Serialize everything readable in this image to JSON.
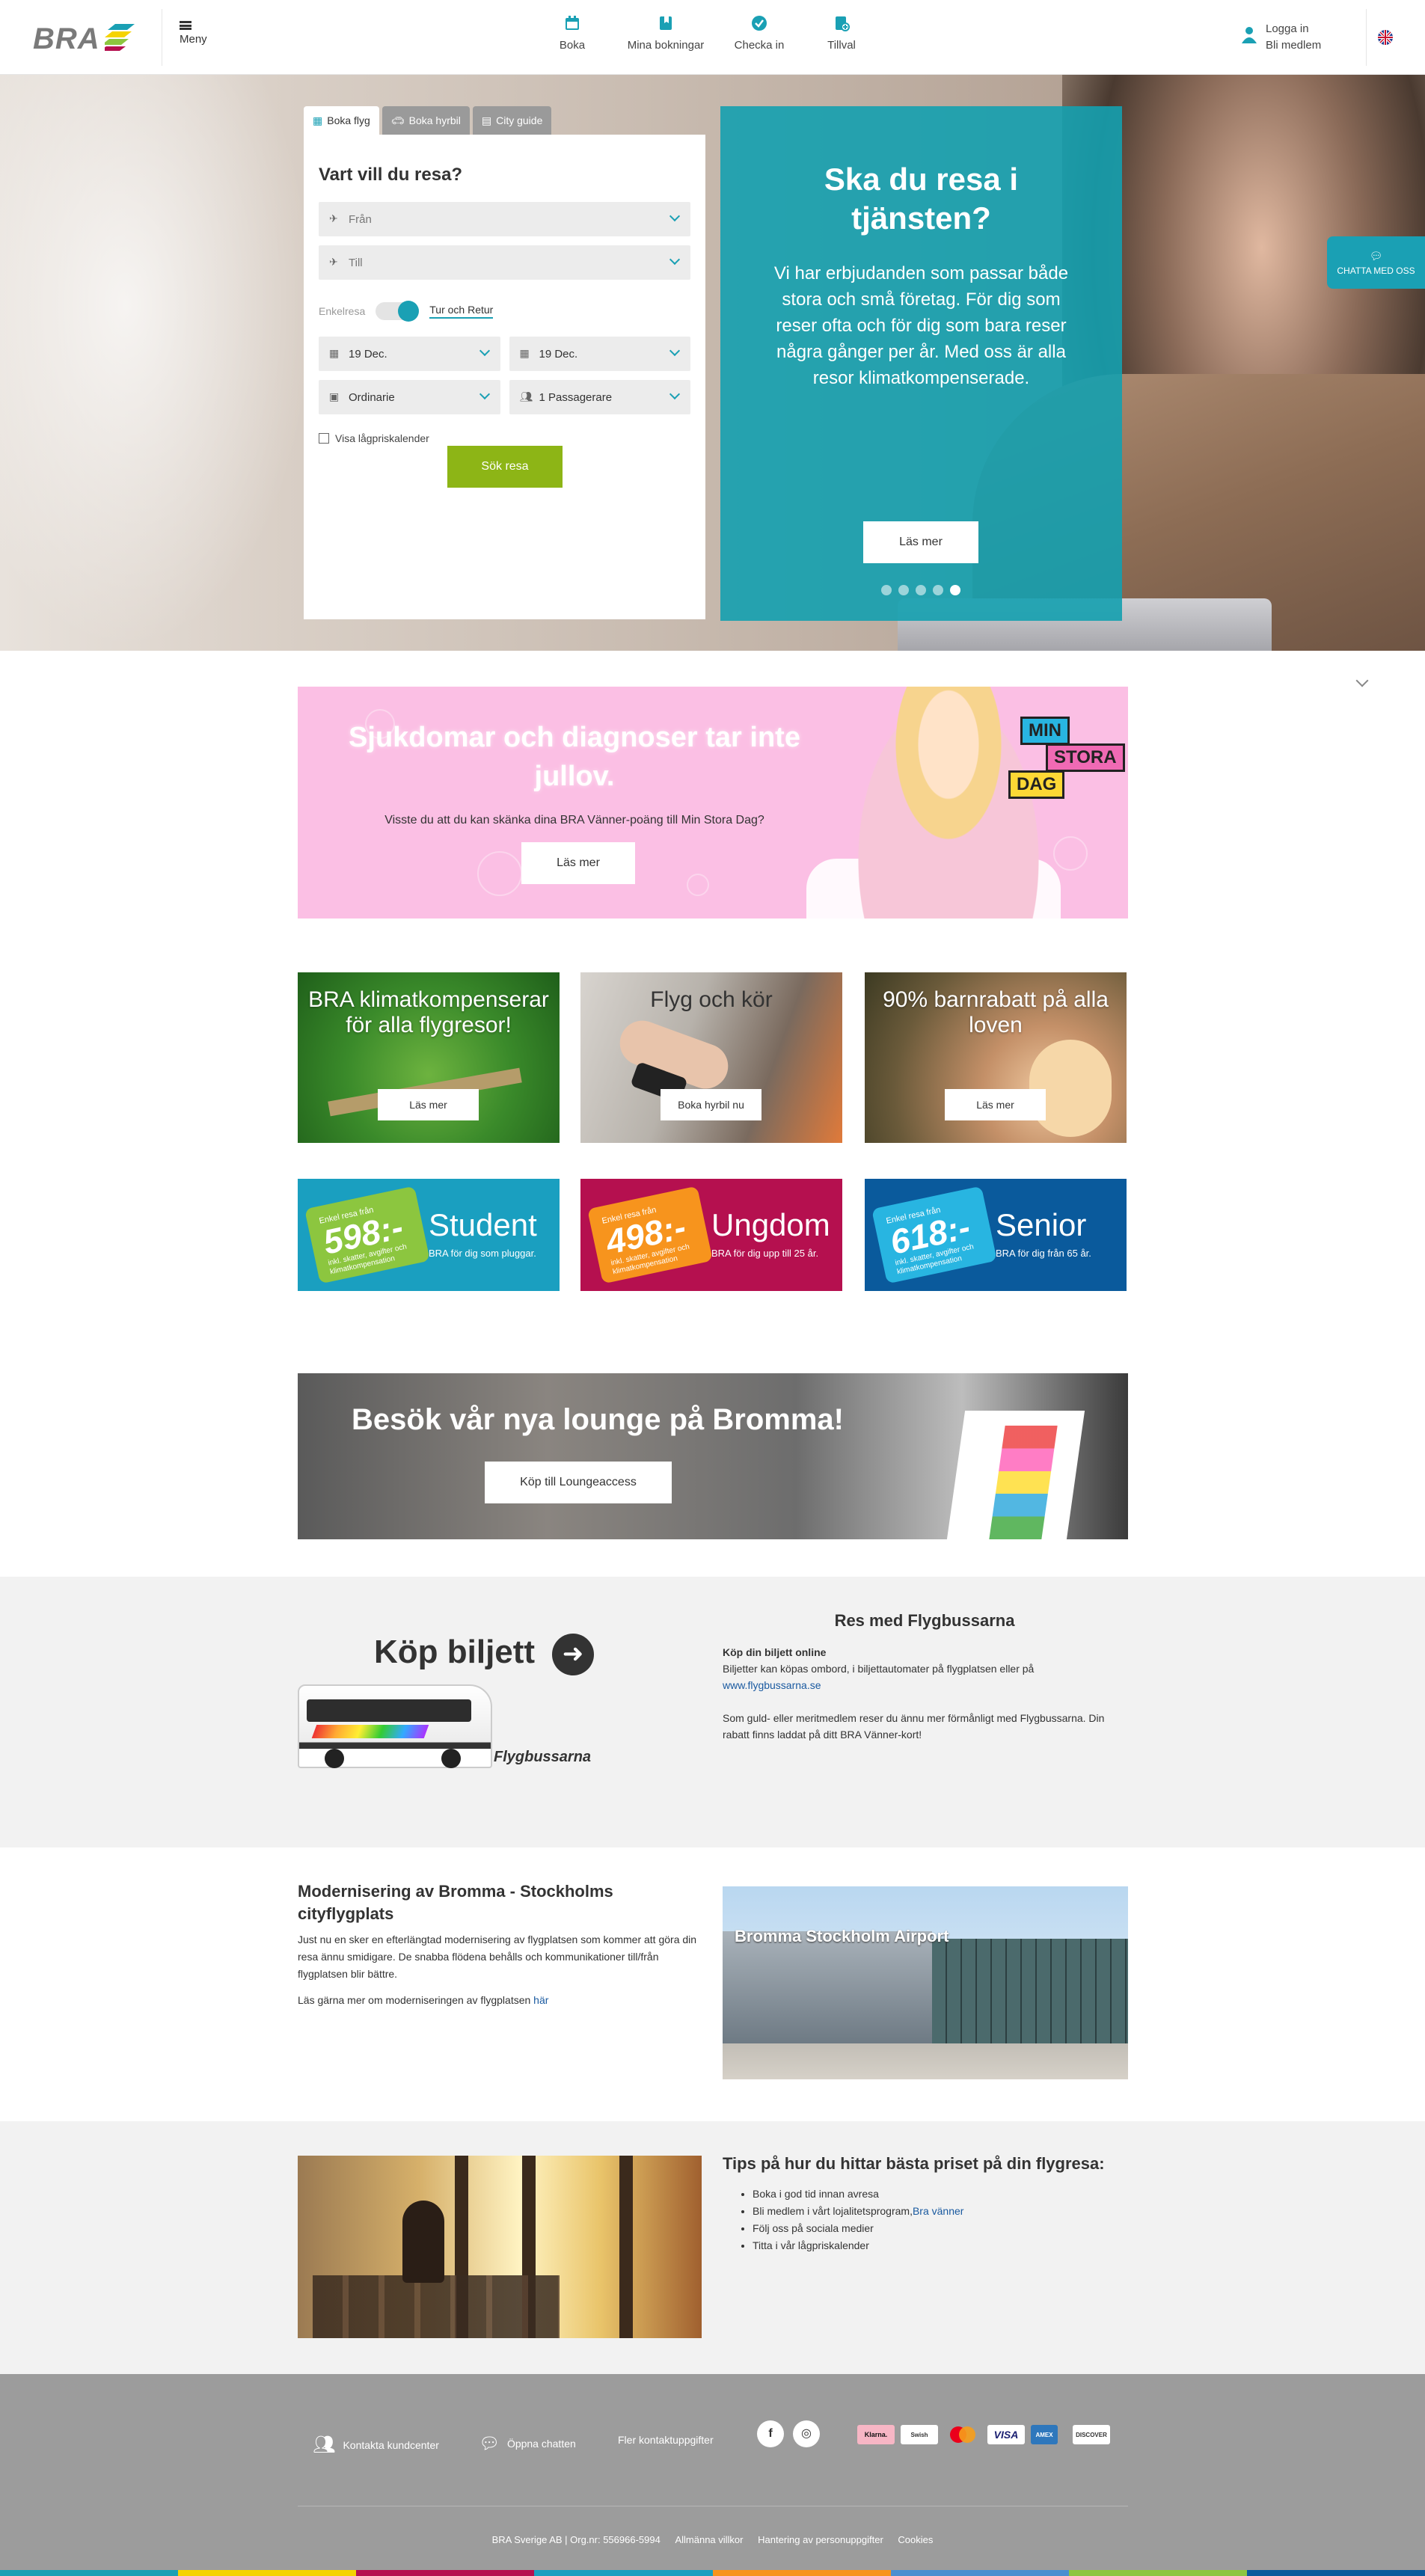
{
  "header": {
    "logo_text": "BRA",
    "menu_label": "Meny",
    "nav": [
      {
        "label": "Boka",
        "icon": "calendar-icon"
      },
      {
        "label": "Mina bokningar",
        "icon": "bookmark-icon"
      },
      {
        "label": "Checka in",
        "icon": "check-circle-icon"
      },
      {
        "label": "Tillval",
        "icon": "addons-icon"
      }
    ],
    "login_label": "Logga in",
    "join_label": "Bli medlem",
    "language_icon": "uk-flag-icon"
  },
  "search": {
    "tabs": [
      "Boka flyg",
      "Boka hyrbil",
      "City guide"
    ],
    "heading": "Vart vill du resa?",
    "from_placeholder": "Från",
    "to_placeholder": "Till",
    "oneway_label": "Enkelresa",
    "return_label": "Tur och Retur",
    "depart_date": "19 Dec.",
    "return_date": "19 Dec.",
    "fare_class": "Ordinarie",
    "passengers": "1 Passagerare",
    "low_price_label": "Visa lågpriskalender",
    "submit_label": "Sök resa"
  },
  "promo": {
    "title": "Ska du resa i tjänsten?",
    "text": "Vi har erbjudanden som passar både stora och små företag. För dig som reser ofta och för dig som bara reser några gånger per år. Med oss är alla resor klimatkompenserade.",
    "button": "Läs mer",
    "slides": 5,
    "active_slide": 5
  },
  "chat": {
    "label": "CHATTA MED OSS"
  },
  "charity": {
    "title": "Sjukdomar och diagnoser tar inte jullov.",
    "text": "Visste du att du kan skänka dina BRA Vänner-poäng till Min Stora Dag?",
    "button": "Läs mer",
    "logo_words": [
      "MIN",
      "STORA",
      "DAG"
    ]
  },
  "tiles": [
    {
      "title": "BRA klimatkompenserar för alla flygresor!",
      "button": "Läs mer"
    },
    {
      "title": "Flyg och kör",
      "button": "Boka hyrbil nu"
    },
    {
      "title": "90% barnrabatt på alla loven",
      "button": "Läs mer"
    }
  ],
  "price_tiles": [
    {
      "top": "Enkel resa från",
      "price": "598:-",
      "bottom": "inkl. skatter, avgifter och klimatkompensation",
      "title": "Student",
      "sub": "BRA för dig som pluggar.",
      "bg": "#1a9fc0",
      "tag": "#8cc63f"
    },
    {
      "top": "Enkel resa från",
      "price": "498:-",
      "bottom": "inkl. skatter, avgifter och klimatkompensation",
      "title": "Ungdom",
      "sub": "BRA för dig upp till 25 år.",
      "bg": "#b5104f",
      "tag": "#f7941d"
    },
    {
      "top": "Enkel resa från",
      "price": "618:-",
      "bottom": "inkl. skatter, avgifter och klimatkompensation",
      "title": "Senior",
      "sub": "BRA för dig från 65 år.",
      "bg": "#0a5a9c",
      "tag": "#28b5e1"
    }
  ],
  "lounge": {
    "title": "Besök vår nya lounge på Bromma!",
    "button": "Köp till Loungeaccess"
  },
  "flygbuss": {
    "buy_title": "Köp biljett",
    "brand": "Flygbussarna",
    "heading": "Res med Flygbussarna",
    "sub": "Köp din biljett online",
    "text1": "Biljetter kan köpas ombord, i biljettautomater på flygplatsen eller på",
    "link": "www.flygbussarna.se",
    "text2": "Som guld- eller meritmedlem reser du ännu mer förmånligt med Flygbussarna. Din rabatt finns laddat på ditt BRA Vänner-kort!"
  },
  "bromma": {
    "title": "Modernisering av Bromma - Stockholms cityflygplats",
    "text1": "Just nu en sker en efterlängtad modernisering av flygplatsen som kommer att göra din resa ännu smidigare. De snabba flödena behålls och kommunikationer till/från flygplatsen blir bättre.",
    "text2": "Läs gärna mer om moderniseringen av flygplatsen",
    "link": "här",
    "image_sign": "Bromma Stockholm Airport"
  },
  "tips": {
    "title": "Tips på hur du hittar bästa priset på din flygresa:",
    "items": [
      "Boka i god tid innan avresa",
      "Bli medlem i vårt lojalitetsprogram,",
      "Följ oss på sociala medier",
      "Titta i vår lågpriskalender"
    ],
    "link": "Bra vänner"
  },
  "footer": {
    "contact": "Kontakta kundcenter",
    "chat": "Öppna chatten",
    "more": "Fler kontaktuppgifter",
    "social": [
      {
        "icon": "facebook-icon",
        "glyph": "f"
      },
      {
        "icon": "instagram-icon",
        "glyph": "◎"
      }
    ],
    "payments": [
      "Klarna.",
      "Swish",
      "Mastercard",
      "VISA",
      "AMEX",
      "DISCOVER"
    ],
    "company": "BRA Sverige AB | Org.nr: 556966-5994",
    "links": [
      "Allmänna villkor",
      "Hantering av personuppgifter",
      "Cookies"
    ],
    "strip_colors": [
      "#1aa0b4",
      "#f5d300",
      "#b5104f",
      "#1a9fc0",
      "#f7941d",
      "#4a8fd0",
      "#8cc63f",
      "#0a5a9c"
    ]
  }
}
